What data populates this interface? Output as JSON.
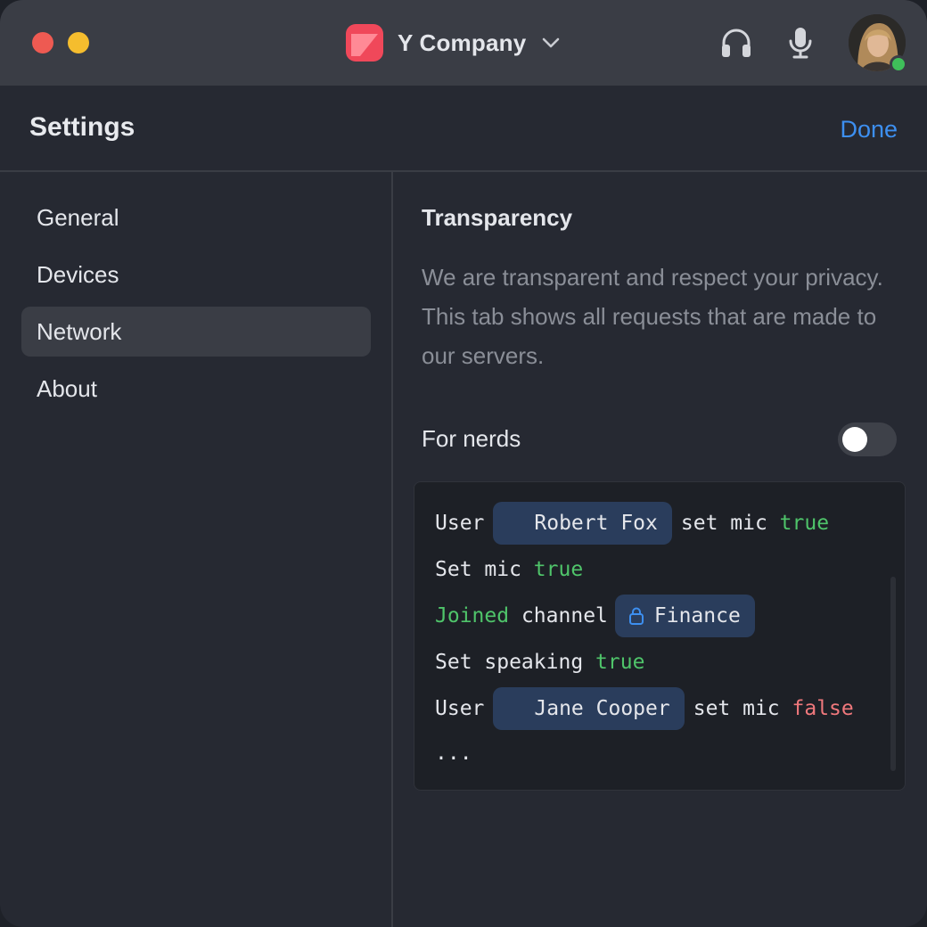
{
  "titlebar": {
    "workspace_name": "Y Company",
    "icons": [
      "close-dot",
      "minimize-dot",
      "chevron-down-icon",
      "headphones-icon",
      "microphone-icon",
      "avatar"
    ],
    "status": "online"
  },
  "header": {
    "title": "Settings",
    "done_label": "Done"
  },
  "sidebar": {
    "items": [
      {
        "label": "General",
        "active": false
      },
      {
        "label": "Devices",
        "active": false
      },
      {
        "label": "Network",
        "active": true
      },
      {
        "label": "About",
        "active": false
      }
    ]
  },
  "content": {
    "section_title": "Transparency",
    "description": "We are transparent and respect your privacy. This tab shows all requests that are made to our servers.",
    "toggle_label": "For nerds",
    "toggle_on": false,
    "log": {
      "line1": {
        "prefix": "User",
        "user": "Robert Fox",
        "action": "set mic",
        "value": "true"
      },
      "line2": {
        "prefix": "Set mic",
        "value": "true"
      },
      "line3": {
        "status": "Joined",
        "text": "channel",
        "channel": "Finance"
      },
      "line4": {
        "prefix": "Set speaking",
        "value": "true"
      },
      "line5": {
        "prefix": "User",
        "user": "Jane Cooper",
        "action": "set mic",
        "value": "false"
      },
      "line6": "..."
    }
  },
  "colors": {
    "accent": "#3d8ff0",
    "true_value": "#4fc46a",
    "false_value": "#f0787c",
    "brand": "#f0485a"
  }
}
